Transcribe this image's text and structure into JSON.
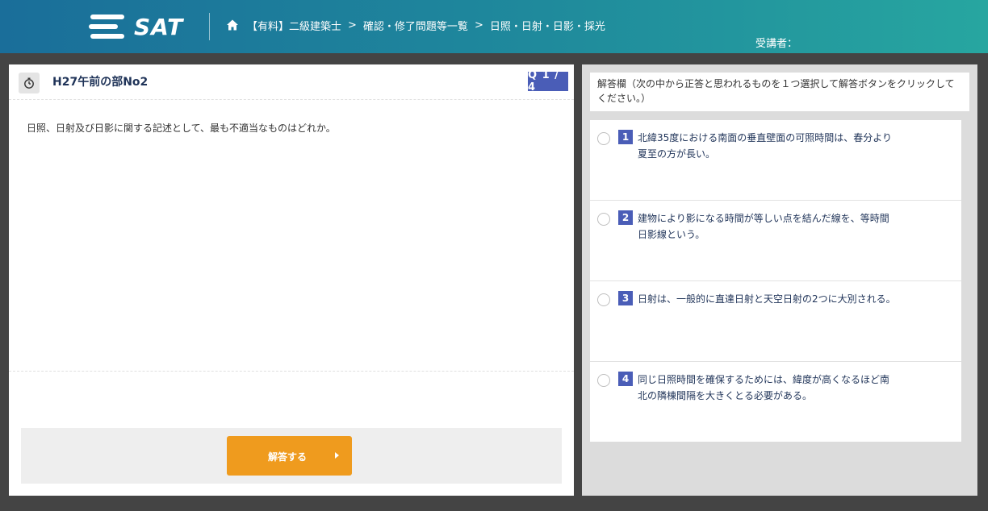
{
  "header": {
    "logo_text": "SAT",
    "breadcrumb": {
      "item1": "【有料】二級建築士",
      "item2": "確認・修了問題等一覧",
      "current": "日照・日射・日影・採光",
      "separator": ">"
    },
    "user_label": "受講者："
  },
  "question": {
    "title": "H27午前の部No2",
    "counter": "Q 1 / 4",
    "text": "日照、日射及び日影に関する記述として、最も不適当なものはどれか。",
    "submit_label": "解答する"
  },
  "answer": {
    "instruction": "解答欄（次の中から正答と思われるものを１つ選択して解答ボタンをクリックしてください。）",
    "choices": [
      {
        "number": "1",
        "line1": "北緯35度における南面の垂直壁面の可照時間は、春分より",
        "line2": "夏至の方が長い。"
      },
      {
        "number": "2",
        "line1": "建物により影になる時間が等しい点を結んだ線を、等時間",
        "line2": "日影線という。"
      },
      {
        "number": "3",
        "line1": "日射は、一般的に直達日射と天空日射の2つに大別される。",
        "line2": ""
      },
      {
        "number": "4",
        "line1": "同じ日照時間を確保するためには、緯度が高くなるほど南",
        "line2": "北の隣棟間隔を大きくとる必要がある。"
      }
    ]
  },
  "colors": {
    "accent_blue": "#4a5db7",
    "submit_orange": "#ef9b1e",
    "header_gradient_start": "#1a6e9a",
    "header_gradient_end": "#27a6a0"
  },
  "icons": {
    "home": "home-icon",
    "timer": "stopwatch-icon",
    "logo": "sat-logo-icon",
    "arrow": "arrow-right-icon"
  }
}
